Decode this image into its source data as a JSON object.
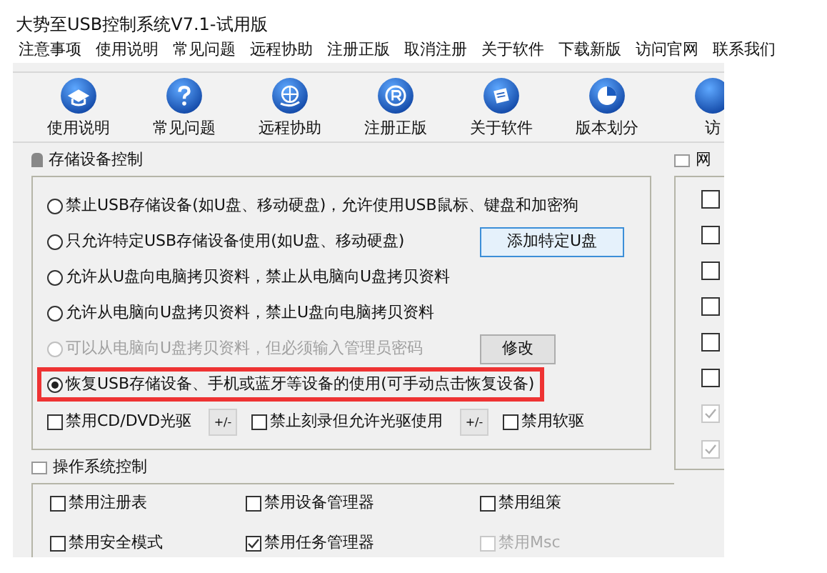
{
  "window": {
    "title": "大势至USB控制系统V7.1-试用版"
  },
  "menu": [
    "注意事项",
    "使用说明",
    "常见问题",
    "远程协助",
    "注册正版",
    "取消注册",
    "关于软件",
    "下载新版",
    "访问官网",
    "联系我们"
  ],
  "toolbar": [
    {
      "kind": "graduation",
      "label": "使用说明"
    },
    {
      "kind": "question",
      "label": "常见问题"
    },
    {
      "kind": "globe",
      "label": "远程协助"
    },
    {
      "kind": "registered",
      "label": "注册正版"
    },
    {
      "kind": "document",
      "label": "关于软件"
    },
    {
      "kind": "pie",
      "label": "版本划分"
    },
    {
      "kind": "blank",
      "label": "访"
    }
  ],
  "storage": {
    "title": "存储设备控制",
    "options": [
      {
        "label": "禁止USB存储设备(如U盘、移动硬盘)，允许使用USB鼠标、键盘和加密狗",
        "selected": false,
        "disabled": false,
        "highlighted": false
      },
      {
        "label": "只允许特定USB存储设备使用(如U盘、移动硬盘)",
        "selected": false,
        "disabled": false,
        "highlighted": false,
        "button": "添加特定U盘"
      },
      {
        "label": "允许从U盘向电脑拷贝资料，禁止从电脑向U盘拷贝资料",
        "selected": false,
        "disabled": false,
        "highlighted": false
      },
      {
        "label": "允许从电脑向U盘拷贝资料，禁止U盘向电脑拷贝资料",
        "selected": false,
        "disabled": false,
        "highlighted": false
      },
      {
        "label": "可以从电脑向U盘拷贝资料，但必须输入管理员密码",
        "selected": false,
        "disabled": true,
        "highlighted": false,
        "button": "修改"
      },
      {
        "label": "恢复USB存储设备、手机或蓝牙等设备的使用(可手动点击恢复设备)",
        "selected": true,
        "disabled": false,
        "highlighted": true
      }
    ],
    "checks": [
      {
        "label": "禁用CD/DVD光驱",
        "checked": false,
        "button": "+/-"
      },
      {
        "label": "禁止刻录但允许光驱使用",
        "checked": false,
        "button": "+/-"
      },
      {
        "label": "禁用软驱",
        "checked": false
      }
    ]
  },
  "network": {
    "title": "网",
    "checks": [
      {
        "checked": false,
        "disabled": false
      },
      {
        "checked": false,
        "disabled": false
      },
      {
        "checked": false,
        "disabled": false
      },
      {
        "checked": false,
        "disabled": false
      },
      {
        "checked": false,
        "disabled": false
      },
      {
        "checked": false,
        "disabled": false
      },
      {
        "checked": true,
        "disabled": true
      },
      {
        "checked": true,
        "disabled": true
      }
    ]
  },
  "os": {
    "title": "操作系统控制",
    "checks": [
      {
        "label": "禁用注册表",
        "checked": false,
        "disabled": false
      },
      {
        "label": "禁用设备管理器",
        "checked": false,
        "disabled": false
      },
      {
        "label": "禁用组策",
        "checked": false,
        "disabled": false
      },
      {
        "label": "禁用安全模式",
        "checked": false,
        "disabled": false
      },
      {
        "label": "禁用任务管理器",
        "checked": true,
        "disabled": false
      },
      {
        "label": "禁用Msc",
        "checked": false,
        "disabled": true
      }
    ]
  }
}
